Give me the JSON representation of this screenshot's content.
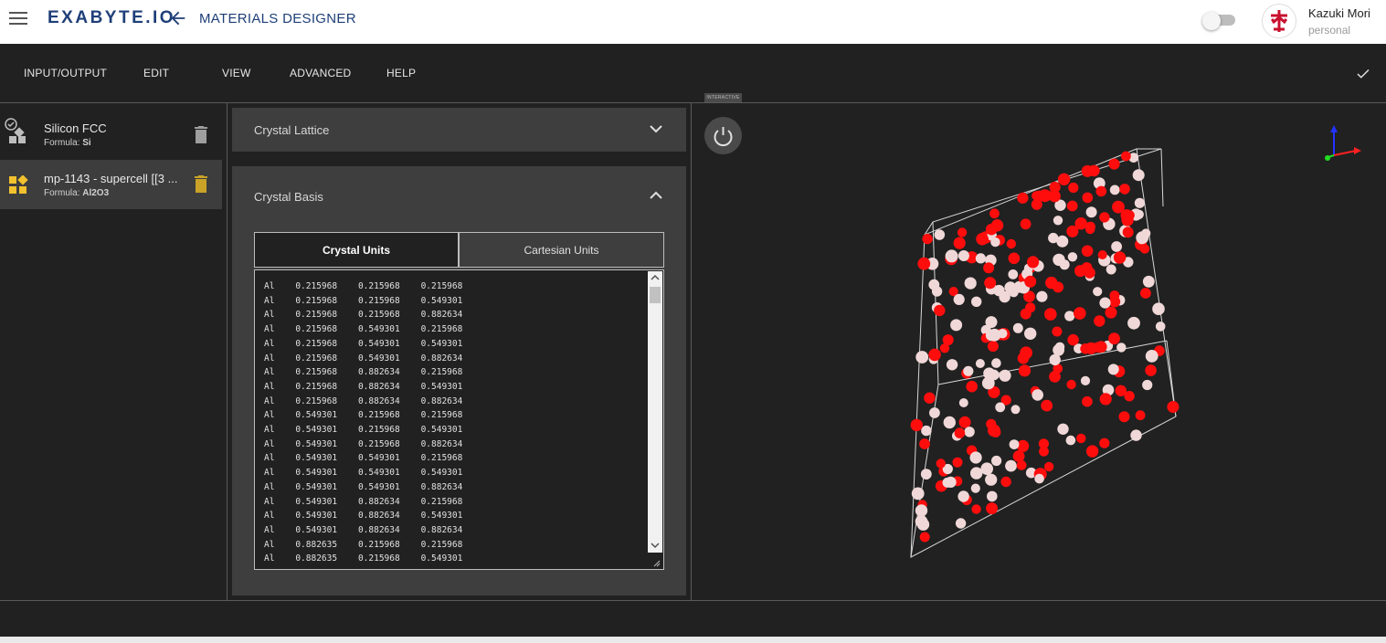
{
  "header": {
    "logo": "EXABYTE.IO",
    "app_title": "MATERIALS DESIGNER",
    "user_name": "Kazuki Mori",
    "user_account": "personal"
  },
  "menu": {
    "items": [
      "INPUT/OUTPUT",
      "EDIT",
      "VIEW",
      "ADVANCED",
      "HELP"
    ]
  },
  "materials": [
    {
      "name": "Silicon FCC",
      "formula_label": "Formula:",
      "formula": "Si",
      "selected": false
    },
    {
      "name": "mp-1143 - supercell [[3 ...",
      "formula_label": "Formula:",
      "formula": "Al2O3",
      "selected": true
    }
  ],
  "panels": {
    "lattice_title": "Crystal Lattice",
    "basis_title": "Crystal Basis",
    "tabs": [
      "Crystal Units",
      "Cartesian Units"
    ],
    "active_tab": "Crystal Units"
  },
  "basis_lines": [
    [
      "Al",
      "0.215968",
      "0.215968",
      "0.215968"
    ],
    [
      "Al",
      "0.215968",
      "0.215968",
      "0.549301"
    ],
    [
      "Al",
      "0.215968",
      "0.215968",
      "0.882634"
    ],
    [
      "Al",
      "0.215968",
      "0.549301",
      "0.215968"
    ],
    [
      "Al",
      "0.215968",
      "0.549301",
      "0.549301"
    ],
    [
      "Al",
      "0.215968",
      "0.549301",
      "0.882634"
    ],
    [
      "Al",
      "0.215968",
      "0.882634",
      "0.215968"
    ],
    [
      "Al",
      "0.215968",
      "0.882634",
      "0.549301"
    ],
    [
      "Al",
      "0.215968",
      "0.882634",
      "0.882634"
    ],
    [
      "Al",
      "0.549301",
      "0.215968",
      "0.215968"
    ],
    [
      "Al",
      "0.549301",
      "0.215968",
      "0.549301"
    ],
    [
      "Al",
      "0.549301",
      "0.215968",
      "0.882634"
    ],
    [
      "Al",
      "0.549301",
      "0.549301",
      "0.215968"
    ],
    [
      "Al",
      "0.549301",
      "0.549301",
      "0.549301"
    ],
    [
      "Al",
      "0.549301",
      "0.549301",
      "0.882634"
    ],
    [
      "Al",
      "0.549301",
      "0.882634",
      "0.215968"
    ],
    [
      "Al",
      "0.549301",
      "0.882634",
      "0.549301"
    ],
    [
      "Al",
      "0.549301",
      "0.882634",
      "0.882634"
    ],
    [
      "Al",
      "0.882635",
      "0.215968",
      "0.215968"
    ],
    [
      "Al",
      "0.882635",
      "0.215968",
      "0.549301"
    ]
  ],
  "viewer": {
    "interactive_label": "INTERACTIVE",
    "atom_colors": {
      "oxygen": "#ff0d0d",
      "aluminum": "#f0d8d8"
    },
    "axis_colors": {
      "x": "#ff2020",
      "y": "#22dd22",
      "z": "#2233ff"
    }
  },
  "colors": {
    "brand": "#1e3f78",
    "selected_icon": "#f2c12e",
    "background_dark": "#212121"
  }
}
